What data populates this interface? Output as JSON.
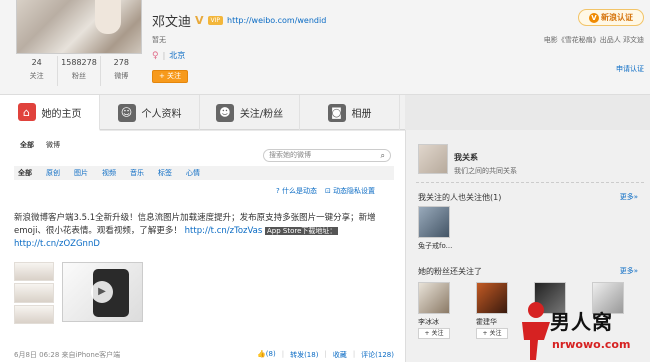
{
  "profile": {
    "name": "邓文迪",
    "v_badge": "V",
    "vip_label": "VIP",
    "url": "http://weibo.com/wendid",
    "intro": "暂无",
    "location": "北京",
    "follow_label": "+ 关注",
    "stats": [
      {
        "num": "24",
        "label": "关注"
      },
      {
        "num": "1588278",
        "label": "粉丝"
      },
      {
        "num": "278",
        "label": "微博"
      }
    ]
  },
  "verify": {
    "label": "新浪认证",
    "desc": "电影《雪花秘扇》出品人 邓文迪",
    "apply": "申请认证"
  },
  "tabs": [
    {
      "label": "她的主页",
      "icon": "home-icon"
    },
    {
      "label": "个人资料",
      "icon": "user-icon"
    },
    {
      "label": "关注/粉丝",
      "icon": "users-icon"
    },
    {
      "label": "相册",
      "icon": "camera-icon"
    }
  ],
  "feed": {
    "subtabs": [
      "全部",
      "微博"
    ],
    "search_placeholder": "搜索她的微博",
    "filters": [
      "全部",
      "原创",
      "图片",
      "视频",
      "音乐",
      "标签",
      "心情"
    ],
    "help": [
      "什么是动态",
      "动态隐私设置"
    ],
    "post": {
      "text": "新浪微博客户端3.5.1全新升级！信息流图片加载速度提升；发布原支持多张图片一键分享；新增emoji、很小花表情。观看视频，了解更多！",
      "link1": "http://t.cn/zTozVas",
      "app_tag": "App Store下载地址：",
      "link2": "http://t.cn/zOZGnnD",
      "time": "6月8日 06:28",
      "source": "来自iPhone客户端",
      "actions": [
        "(8)",
        "转发(18)",
        "收藏",
        "评论(128)"
      ]
    }
  },
  "sidebar": {
    "rel_title": "我关系",
    "rel_sub": "我们之间的共同关系",
    "follow_section": "我关注的人也关注他(1)",
    "follow_more": "更多»",
    "follow_user": "兔子戒fo...",
    "fans_section": "她的粉丝还关注了",
    "fans_more": "更多»",
    "fans": [
      {
        "name": "李冰冰",
        "btn": "+ 关注"
      },
      {
        "name": "霍建华",
        "btn": "+ 关注"
      },
      {
        "name": "",
        "btn": ""
      },
      {
        "name": "",
        "btn": ""
      }
    ]
  },
  "watermark": {
    "text": "男人窝",
    "url": "nrwowo.com"
  }
}
